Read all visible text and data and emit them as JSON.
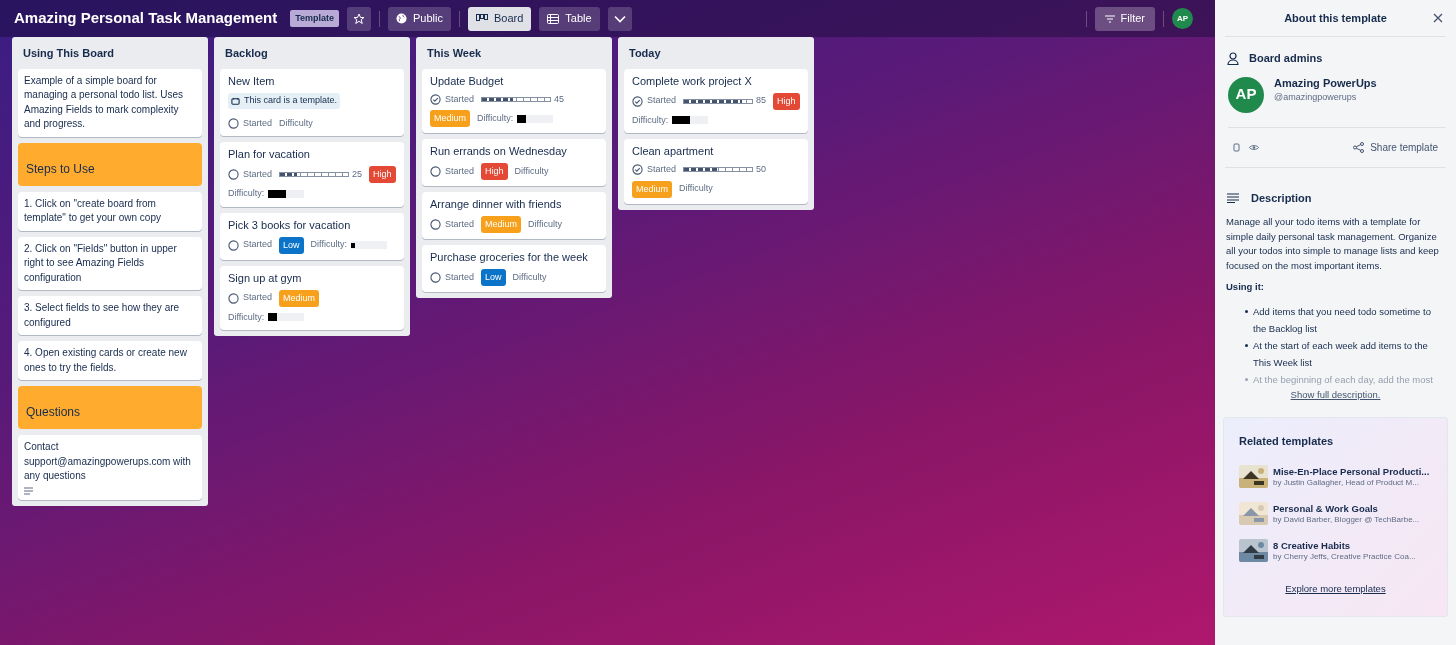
{
  "board": {
    "title": "Amazing Personal Task Management",
    "badge": "Template",
    "starred": false,
    "visibility": "Public",
    "views": [
      {
        "label": "Board",
        "selected": true
      },
      {
        "label": "Table",
        "selected": false
      }
    ],
    "filter": "Filter",
    "avatar": "AP"
  },
  "lists": [
    {
      "title": "Using This Board",
      "cards": [
        {
          "kind": "text",
          "text": "Example of a simple board for managing a personal todo list. Uses Amazing Fields to mark complexity and progress."
        },
        {
          "kind": "header",
          "text": "Steps to Use"
        },
        {
          "kind": "text",
          "text": "1. Click on \"create board from template\" to get your own copy"
        },
        {
          "kind": "text",
          "text": "2. Click on \"Fields\" button in upper right to see Amazing Fields configuration"
        },
        {
          "kind": "text",
          "text": "3. Select fields to see how they are configured"
        },
        {
          "kind": "text",
          "text": "4. Open existing cards or create new ones to try the fields."
        },
        {
          "kind": "header",
          "text": "Questions"
        },
        {
          "kind": "text",
          "text": "Contact support@amazingpowerups.com with any questions",
          "has_description": true
        }
      ]
    },
    {
      "title": "Backlog",
      "cards": [
        {
          "kind": "task",
          "title": "New Item",
          "template_note": "This card is a template.",
          "started": {
            "label": "Started",
            "checked": false
          },
          "difficulty": {
            "label": "Difficulty"
          }
        },
        {
          "kind": "task",
          "title": "Plan for vacation",
          "started": {
            "label": "Started",
            "checked": false
          },
          "progress": {
            "level": 0.25,
            "reading": "25"
          },
          "priority": {
            "text": "High",
            "color": "#e34935"
          },
          "difficulty": {
            "label": "Difficulty:",
            "level": 0.5
          }
        },
        {
          "kind": "task",
          "title": "Pick 3 books for vacation",
          "started": {
            "label": "Started",
            "checked": false
          },
          "priority": {
            "text": "Low",
            "color": "#0c74c8"
          },
          "difficulty": {
            "label": "Difficulty:",
            "level": 0.125
          }
        },
        {
          "kind": "task",
          "title": "Sign up at gym",
          "started": {
            "label": "Started",
            "checked": false
          },
          "priority": {
            "text": "Medium",
            "color": "#f7a01c"
          },
          "difficulty": {
            "label": "Difficulty:",
            "level": 0.25
          }
        }
      ]
    },
    {
      "title": "This Week",
      "cards": [
        {
          "kind": "task",
          "title": "Update Budget",
          "started": {
            "label": "Started",
            "checked": true
          },
          "progress": {
            "level": 0.45,
            "reading": "45"
          },
          "priority": {
            "text": "Medium",
            "color": "#f7a01c"
          },
          "difficulty": {
            "label": "Difficulty:",
            "level": 0.25
          }
        },
        {
          "kind": "task",
          "title": "Run errands on Wednesday",
          "started": {
            "label": "Started",
            "checked": false
          },
          "priority": {
            "text": "High",
            "color": "#e34935"
          },
          "difficulty": {
            "label": "Difficulty"
          }
        },
        {
          "kind": "task",
          "title": "Arrange dinner with friends",
          "started": {
            "label": "Started",
            "checked": false
          },
          "priority": {
            "text": "Medium",
            "color": "#f7a01c"
          },
          "difficulty": {
            "label": "Difficulty"
          }
        },
        {
          "kind": "task",
          "title": "Purchase groceries for the week",
          "started": {
            "label": "Started",
            "checked": false
          },
          "priority": {
            "text": "Low",
            "color": "#0c74c8"
          },
          "difficulty": {
            "label": "Difficulty"
          }
        }
      ]
    },
    {
      "title": "Today",
      "cards": [
        {
          "kind": "task",
          "title": "Complete work project X",
          "started": {
            "label": "Started",
            "checked": true
          },
          "progress": {
            "level": 0.85,
            "reading": "85"
          },
          "priority": {
            "text": "High",
            "color": "#e34935"
          },
          "difficulty": {
            "label": "Difficulty:",
            "level": 0.5
          }
        },
        {
          "kind": "task",
          "title": "Clean apartment",
          "started": {
            "label": "Started",
            "checked": true
          },
          "progress": {
            "level": 0.5,
            "reading": "50"
          },
          "priority": {
            "text": "Medium",
            "color": "#f7a01c"
          },
          "difficulty": {
            "label": "Difficulty"
          }
        }
      ]
    }
  ],
  "panel": {
    "title": "About this template",
    "admins_heading": "Board admins",
    "admin": {
      "avatar": "AP",
      "name": "Amazing PowerUps",
      "handle": "@amazingpowerups"
    },
    "share": "Share template",
    "description_heading": "Description",
    "description": "Manage all your todo items with a template for simple daily personal task management. Organize all your todos into simple to manage lists and keep focused on the most important items.",
    "using_heading": "Using it:",
    "bullets": [
      "Add items that you need todo sometime to the Backlog list",
      "At the start of each week add items to the This Week list",
      "At the beginning of each day, add the most"
    ],
    "show_more": "Show full description.",
    "related_heading": "Related templates",
    "related": [
      {
        "title": "Mise-En-Place Personal Producti...",
        "byline": "by Justin Gallagher, Head of Product M..."
      },
      {
        "title": "Personal & Work Goals",
        "byline": "by David Barber, Blogger @ TechBarbe..."
      },
      {
        "title": "8 Creative Habits",
        "byline": "by Cherry Jeffs, Creative Practice Coa..."
      }
    ],
    "explore": "Explore more templates"
  }
}
